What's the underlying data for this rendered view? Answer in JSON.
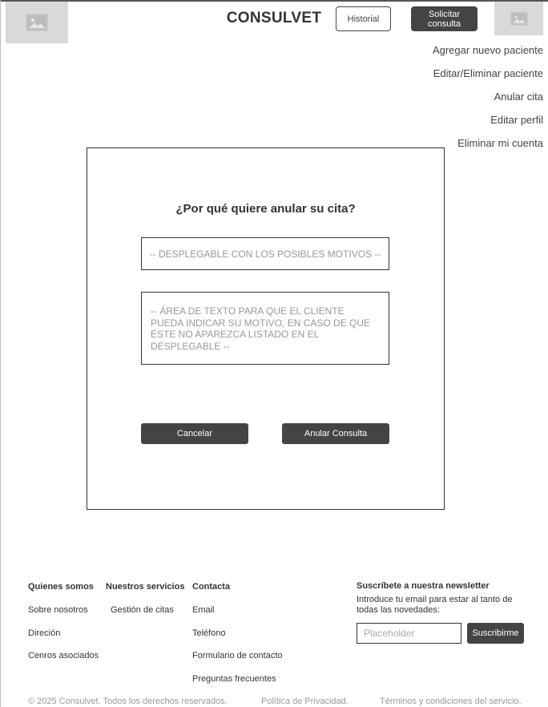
{
  "header": {
    "logo_icon": "image-icon",
    "avatar_icon": "image-icon",
    "brand": "CONSULVET",
    "history_button": "Historial",
    "request_button": "Solicitar consulta"
  },
  "side_menu": {
    "items": [
      "Agregar nuevo paciente",
      "Editar/Eliminar paciente",
      "Anular cita",
      "Editar perfil",
      "Eliminar mi cuenta"
    ]
  },
  "modal": {
    "title": "¿Por qué quiere anular su cita?",
    "select_placeholder": "-- DESPLEGABLE CON LOS POSIBLES MOTIVOS --",
    "textarea_placeholder": "-- ÁREA DE TEXTO PARA QUE EL CLIENTE PUEDA INDICAR SU MOTIVO, EN CASO DE QUE ÉSTE NO APAREZCA LISTADO EN EL DESPLEGABLE --",
    "cancel_button": "Cancelar",
    "confirm_button": "Anular Consulta"
  },
  "footer": {
    "columns": [
      {
        "title": "Quienes somos",
        "links": [
          "Sobre nosotros",
          "Direción",
          "Cenros asociados"
        ]
      },
      {
        "title": "Nuestros servicios",
        "links": [
          "Gestión de citas"
        ]
      },
      {
        "title": "Contacta",
        "links": [
          "Email",
          "Teléfono",
          "Formulario de contacto",
          "Preguntas frecuentes"
        ]
      }
    ],
    "newsletter": {
      "title": "Suscríbete a nuestra newsletter",
      "description": "Introduce tu email para estar al tanto de todas las novedades:",
      "placeholder": "Placeholder",
      "button": "Suscribirme"
    },
    "copyright": "© 2025 Consulvet. Todos los derechos reservados.",
    "privacy": "Política de Privacidad.",
    "terms": "Términos y condiciones del servicio."
  },
  "colors": {
    "dark_button": "#444444",
    "placeholder_bg": "#d9d9d9",
    "muted_text": "#999999"
  }
}
